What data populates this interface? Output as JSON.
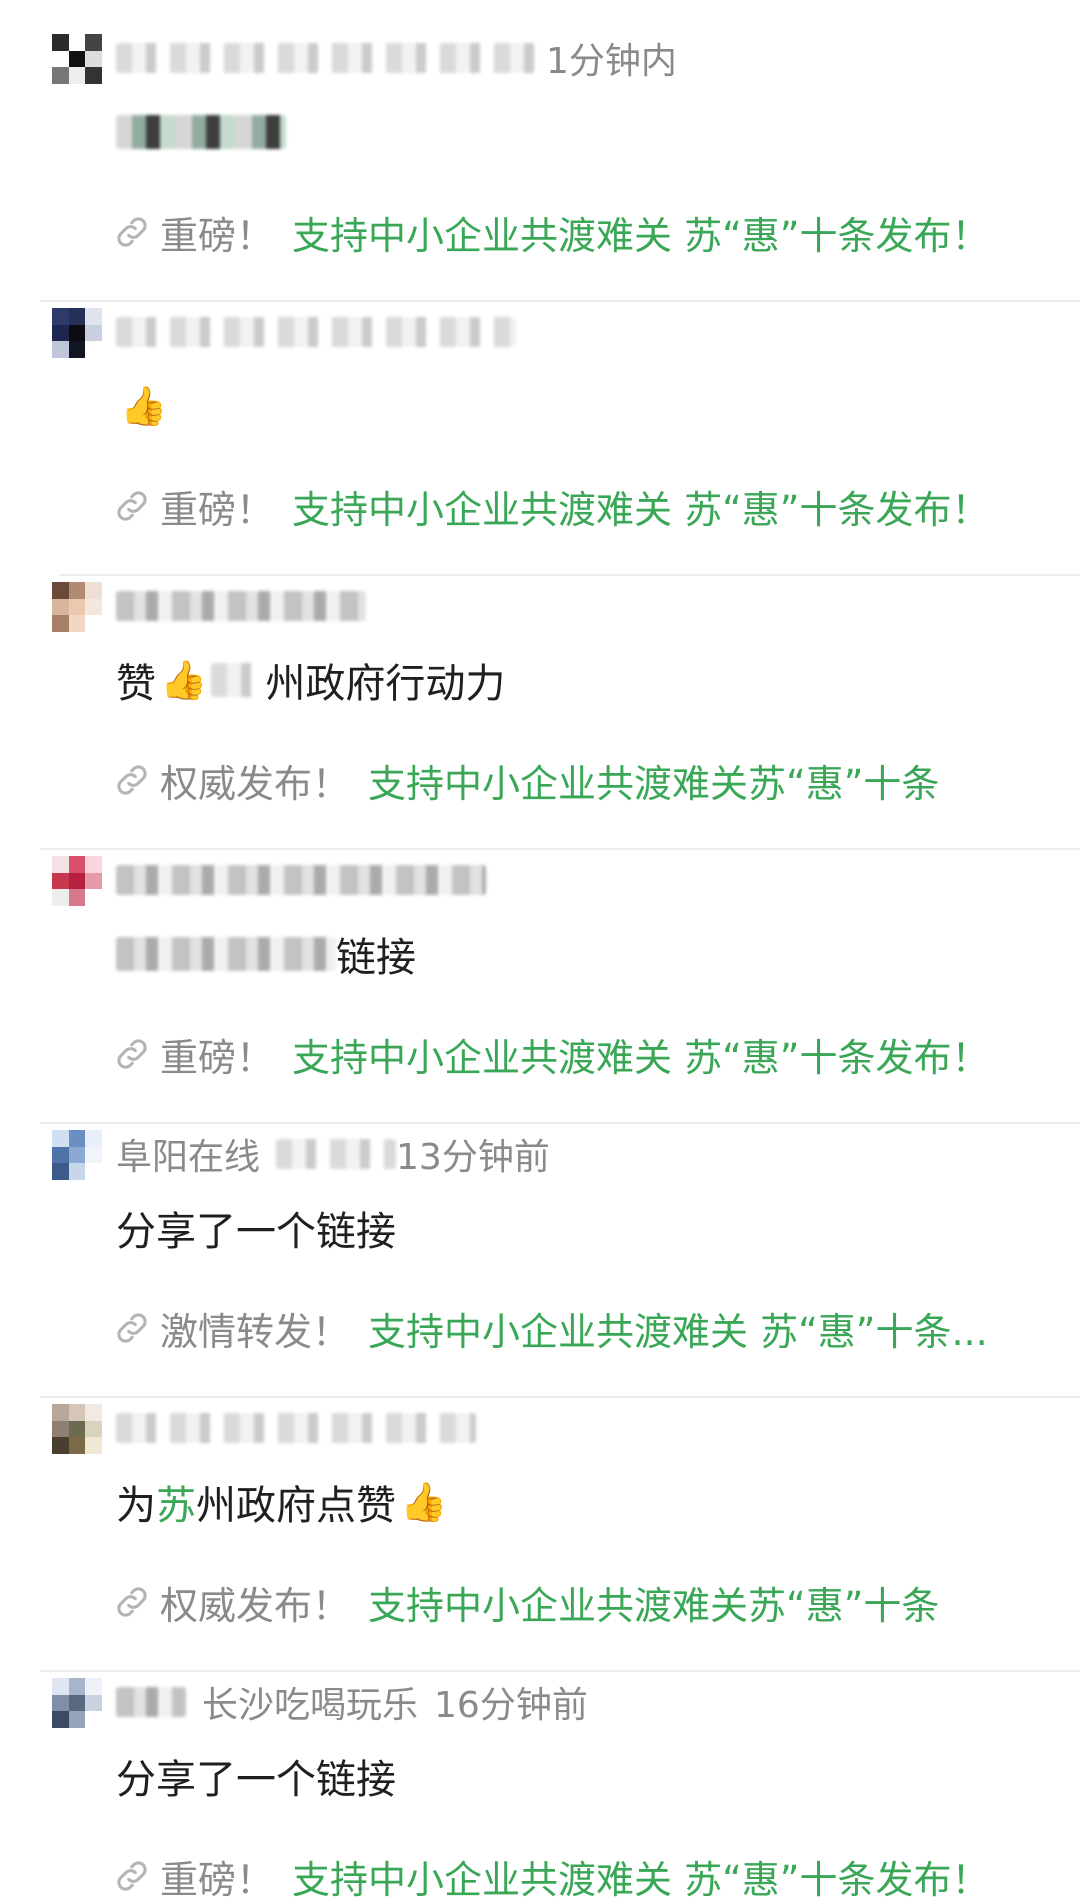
{
  "colors": {
    "accent_green": "#3aa757",
    "meta_gray": "#8a8a8a",
    "text": "#1f1f1f",
    "divider": "#ececec"
  },
  "icons": {
    "link": "link-icon",
    "thumbs_up": "thumbs-up-icon"
  },
  "posts": [
    {
      "meta_suffix": "1分钟内",
      "body_text": "",
      "link_prefix": "重磅！",
      "link_title": "支持中小企业共渡难关 苏“惠”十条发布！"
    },
    {
      "meta_suffix": "",
      "body_emoji": "👍",
      "link_prefix": "重磅！",
      "link_title": "支持中小企业共渡难关 苏“惠”十条发布！"
    },
    {
      "meta_suffix": "",
      "body_pre": "赞",
      "body_emoji": "👍",
      "body_post": "州政府行动力",
      "link_prefix": "权威发布！",
      "link_title": "支持中小企业共渡难关苏“惠”十条"
    },
    {
      "meta_suffix": "",
      "body_post": "链接",
      "link_prefix": "重磅！",
      "link_title": "支持中小企业共渡难关 苏“惠”十条发布！"
    },
    {
      "meta_name": "阜阳在线",
      "meta_time": "13分钟前",
      "body_text": "分享了一个链接",
      "link_prefix": "激情转发！",
      "link_title": "支持中小企业共渡难关 苏“惠”十条..."
    },
    {
      "body_pre": "为",
      "body_green": "苏",
      "body_post": "州政府点赞",
      "body_emoji": "👍",
      "link_prefix": "权威发布！",
      "link_title": "支持中小企业共渡难关苏“惠”十条"
    },
    {
      "meta_name": "长沙吃喝玩乐",
      "meta_time": "16分钟前",
      "body_text": "分享了一个链接",
      "link_prefix": "重磅！",
      "link_title": "支持中小企业共渡难关 苏“惠”十条发布！"
    }
  ]
}
